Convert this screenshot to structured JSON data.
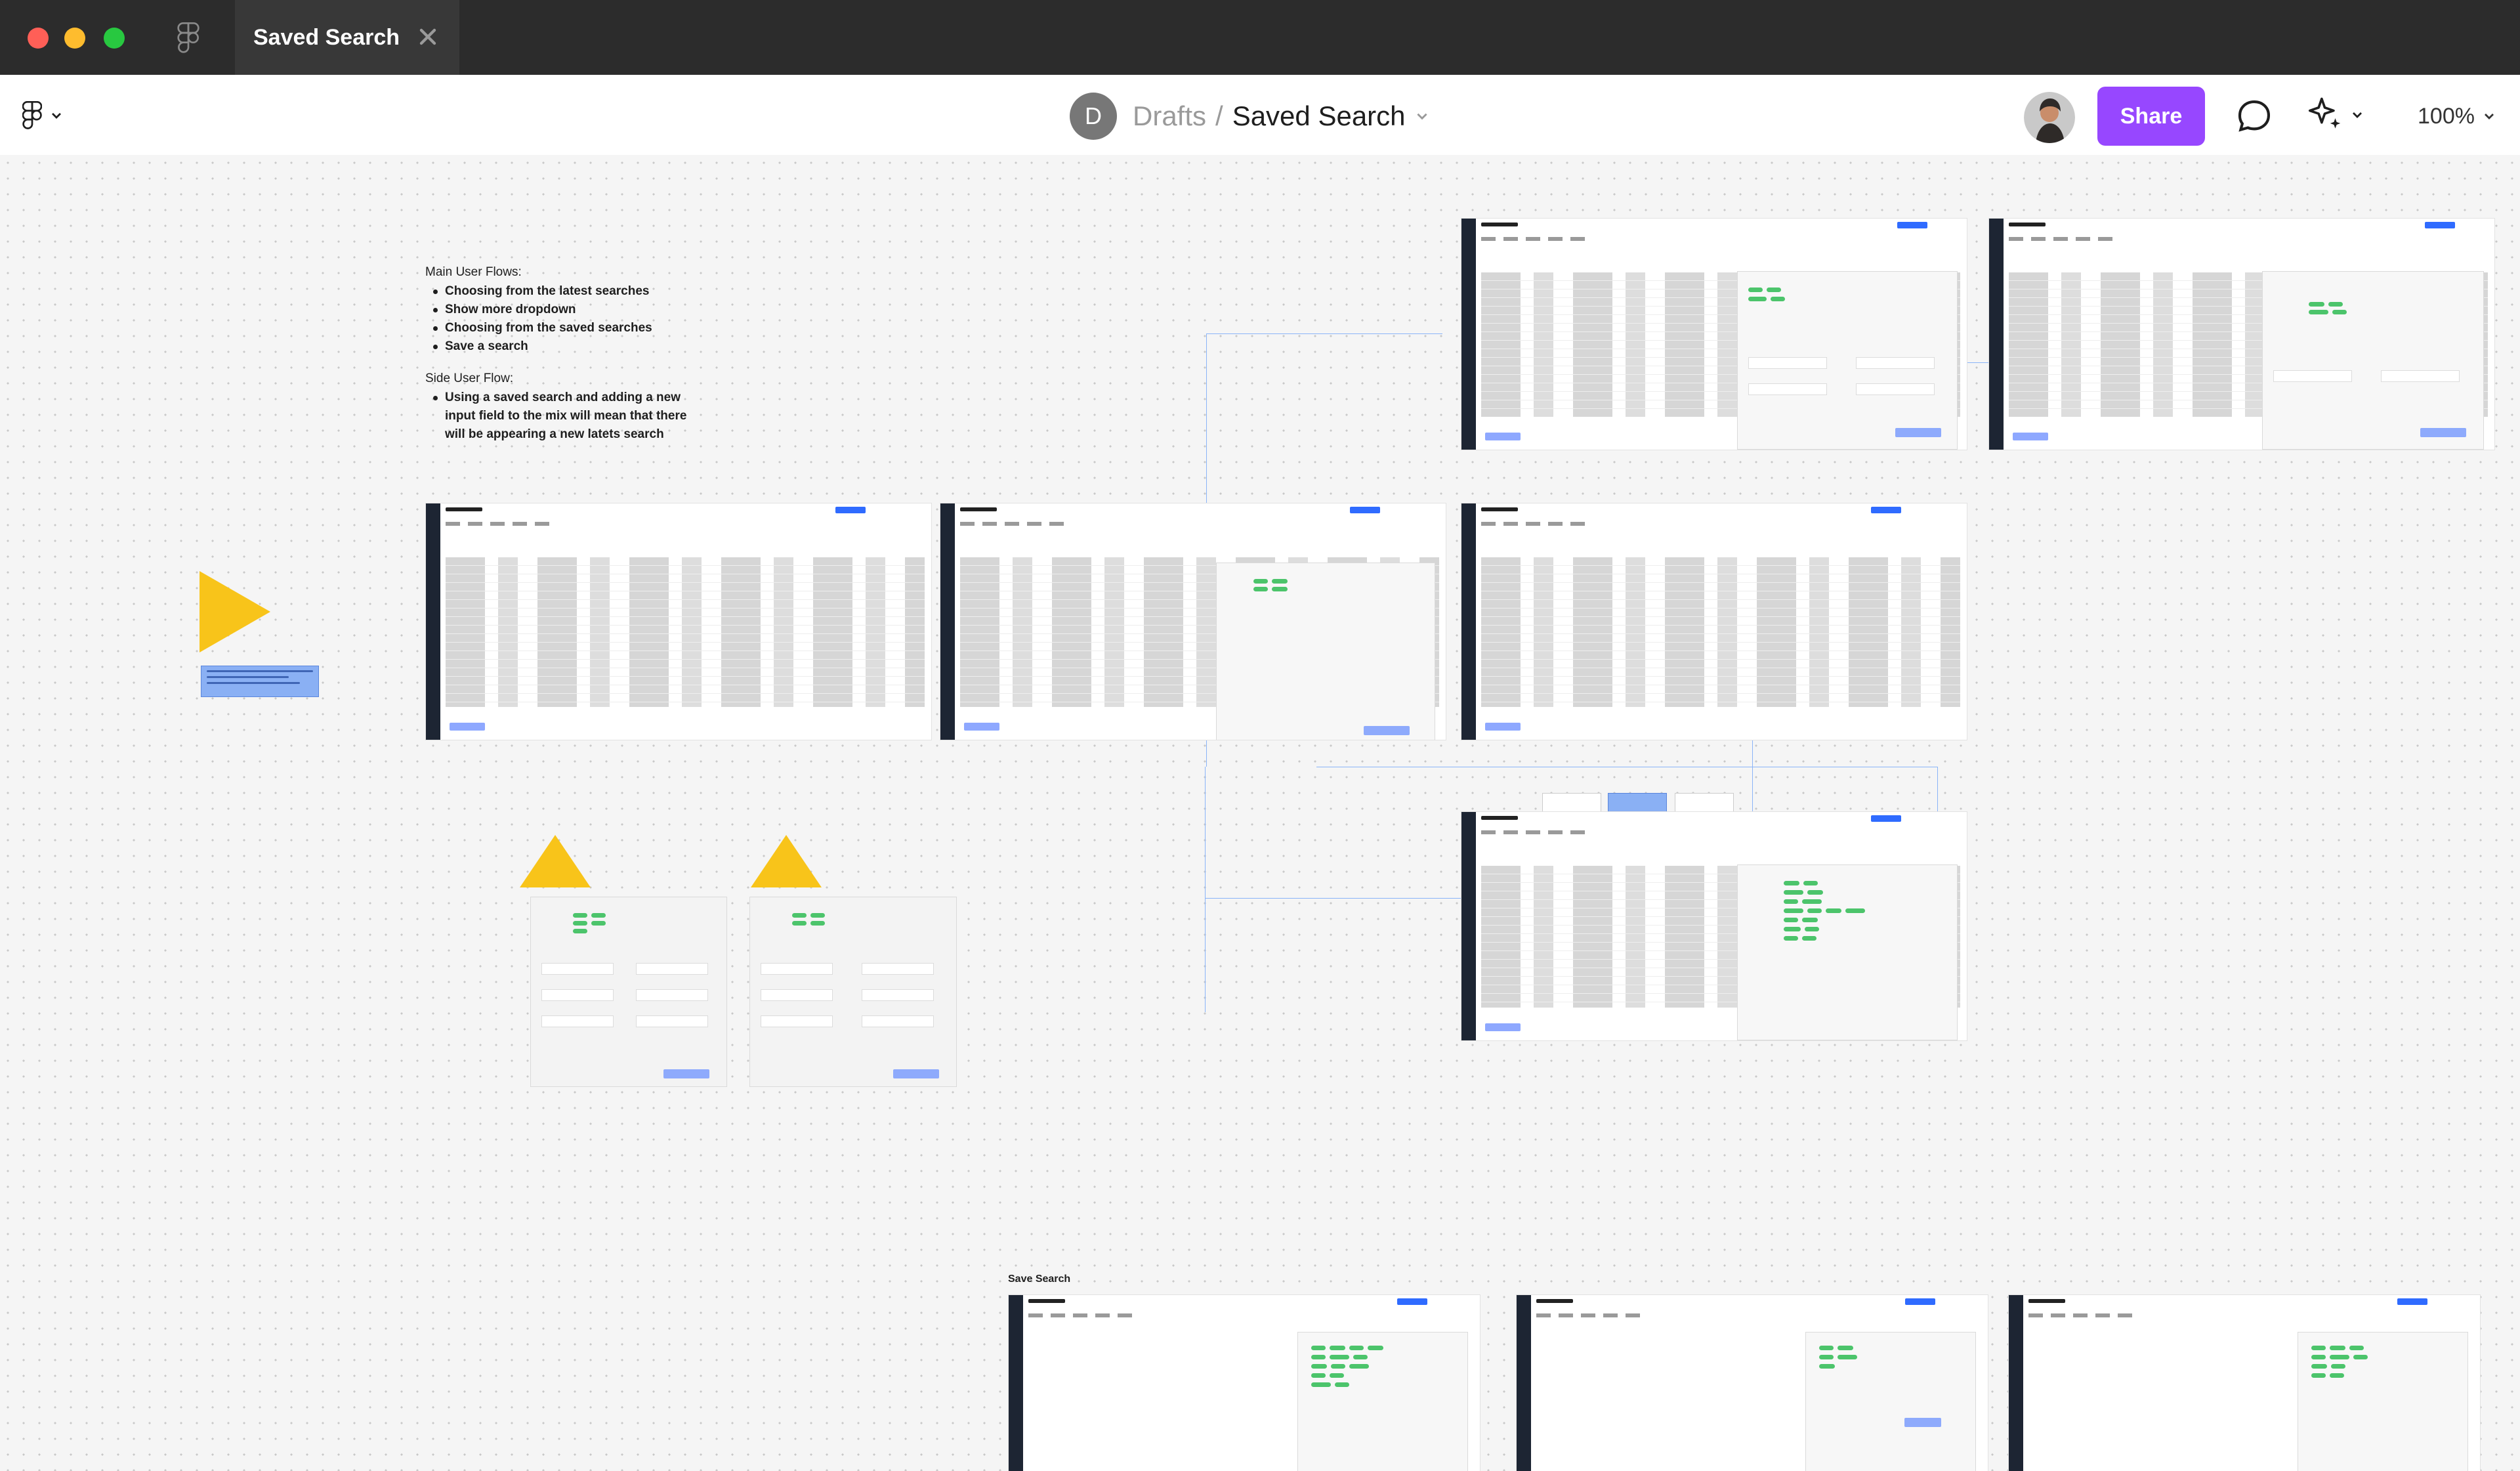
{
  "window": {
    "tab_title": "Saved Search"
  },
  "toolbar": {
    "project_initial": "D",
    "project": "Drafts",
    "separator": "/",
    "file_name": "Saved Search",
    "share_label": "Share",
    "zoom": "100%"
  },
  "canvas": {
    "notes": {
      "main_heading": "Main User Flows:",
      "main_items": [
        "Choosing from the latest searches",
        "Show more dropdown",
        "Choosing from the saved searches",
        "Save a search"
      ],
      "side_heading": "Side User Flow:",
      "side_items": [
        "Using a saved search and adding a new input field to the mix will mean that there will be appearing a new latets search"
      ]
    },
    "section_label": "Save Search"
  },
  "colors": {
    "titlebar": "#2c2c2c",
    "share_button": "#9747ff",
    "sticky_yellow": "#f8c41a",
    "accent_blue": "#2f6bff",
    "pill_green": "#4cc46b"
  },
  "icons": {
    "figma_logo": "figma-logo-icon",
    "close_tab": "close-icon",
    "main_menu": "figma-menu-icon",
    "comment": "comment-icon",
    "ai": "sparkle-icon",
    "chevron": "chevron-down-icon"
  }
}
